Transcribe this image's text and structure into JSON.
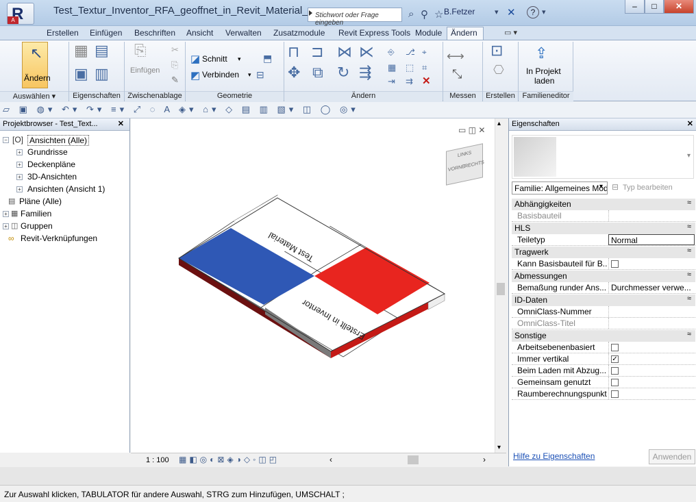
{
  "title": "Test_Textur_Inventor_RFA_geoffnet_in_Revit_Material_z...",
  "search_placeholder": "Stichwort oder Frage eingeben",
  "user": "B.Fetzer",
  "tabs": [
    "Erstellen",
    "Einfügen",
    "Beschriften",
    "Ansicht",
    "Verwalten",
    "Zusatzmodule",
    "Revit Express Tools",
    "Module",
    "Ändern"
  ],
  "active_tab": "Ändern",
  "ribbon": {
    "aendern": "Ändern",
    "einfuegen": "Einfügen",
    "schnitt": "Schnitt",
    "verbinden": "Verbinden",
    "in_projekt_1": "In Projekt",
    "in_projekt_2": "laden",
    "panels": [
      "Auswählen ▾",
      "Eigenschaften",
      "Zwischenablage",
      "Geometrie",
      "Ändern",
      "Messen",
      "Erstellen",
      "Familieneditor"
    ]
  },
  "project_browser": {
    "title": "Projektbrowser - Test_Text...",
    "items": [
      "Ansichten (Alle)",
      "Grundrisse",
      "Deckenpläne",
      "3D-Ansichten",
      "Ansichten (Ansicht 1)",
      "Pläne (Alle)",
      "Familien",
      "Gruppen",
      "Revit-Verknüpfungen"
    ]
  },
  "canvas": {
    "text_top": "Test Material",
    "text_bottom": "Erstellt in Inventor",
    "viewcube_1": "LINKS",
    "viewcube_2": "VORNE",
    "viewcube_3": "RECHTS",
    "colors": {
      "blue": "#2f58b5",
      "red": "#e8251f",
      "side_red": "#c41a16",
      "side_gray": "#7a7a7a",
      "side_dark": "#6b1010"
    }
  },
  "view_bar": {
    "scale": "1 : 100"
  },
  "properties": {
    "title": "Eigenschaften",
    "family": "Familie: Allgemeines Modell",
    "type_edit": "Typ bearbeiten",
    "rows": [
      {
        "group": "Abhängigkeiten"
      },
      {
        "key": "Basisbauteil",
        "value": "",
        "dim": true
      },
      {
        "group": "HLS"
      },
      {
        "key": "Teiletyp",
        "value": "Normal"
      },
      {
        "group": "Tragwerk"
      },
      {
        "key": "Kann Basisbauteil für B...",
        "check": false
      },
      {
        "group": "Abmessungen"
      },
      {
        "key": "Bemaßung runder Ans...",
        "value": "Durchmesser verwe..."
      },
      {
        "group": "ID-Daten"
      },
      {
        "key": "OmniClass-Nummer",
        "value": ""
      },
      {
        "key": "OmniClass-Titel",
        "value": "",
        "dim": true
      },
      {
        "group": "Sonstige"
      },
      {
        "key": "Arbeitsebenenbasiert",
        "check": false
      },
      {
        "key": "Immer vertikal",
        "check": true
      },
      {
        "key": "Beim Laden mit Abzug...",
        "check": false
      },
      {
        "key": "Gemeinsam genutzt",
        "check": false
      },
      {
        "key": "Raumberechnungspunkt",
        "check": false
      }
    ],
    "help_link": "Hilfe zu Eigenschaften",
    "apply": "Anwenden"
  },
  "status_text": "Zur Auswahl klicken, TABULATOR für andere Auswahl, STRG zum Hinzufügen, UMSCHALT ;"
}
